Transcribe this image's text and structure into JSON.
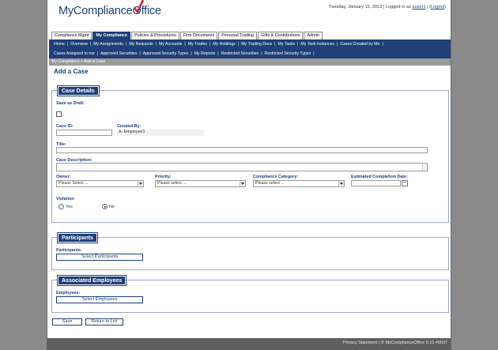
{
  "header": {
    "logo_main": "MyCompliance",
    "logo_check_letter": "O",
    "logo_end": "ffice",
    "date": "Tuesday, January 15, 2013",
    "logged_in_as_label": "| Logged in as",
    "user": "auser1",
    "logout": "Logout"
  },
  "tabs": [
    {
      "label": "Compliance Mgmt"
    },
    {
      "label": "My Compliance"
    },
    {
      "label": "Policies & Procedures"
    },
    {
      "label": "Firm Documents"
    },
    {
      "label": "Personal Trading"
    },
    {
      "label": "Gifts & Contributions"
    },
    {
      "label": "Admin"
    }
  ],
  "nav_row1": [
    {
      "label": "Home"
    },
    {
      "label": "Overview"
    },
    {
      "label": "My Assignments"
    },
    {
      "label": "My Requests"
    },
    {
      "label": "My Accounts"
    },
    {
      "label": "My Trades"
    },
    {
      "label": "My Holdings"
    },
    {
      "label": "My Trading Docs"
    },
    {
      "label": "My Tasks"
    },
    {
      "label": "My Task Instances"
    },
    {
      "label": "Cases Created by Me"
    }
  ],
  "nav_row2": [
    {
      "label": "Cases Assigned to me"
    },
    {
      "label": "Approved Securities"
    },
    {
      "label": "Approved Security Types"
    },
    {
      "label": "My Reports"
    },
    {
      "label": "Restricted Securities"
    },
    {
      "label": "Restricted Security Types"
    }
  ],
  "breadcrumb": "My Compliance »  Add a Case",
  "page_title": "Add a Case",
  "case_details": {
    "legend": "Case Details",
    "save_as_draft_label": "Save as Draft:",
    "case_id_label": "Case ID:",
    "case_id_value": "",
    "created_by_label": "Created By:",
    "created_by_value": "A. Employee1",
    "title_label": "Title:",
    "title_value": "",
    "description_label": "Case Description:",
    "owner_label": "Owner:",
    "owner_value": "Please Select ...",
    "priority_label": "Priority:",
    "priority_value": "Please select ...",
    "category_label": "Compliance Category:",
    "category_value": "Please select ...",
    "est_date_label": "Estimated Completion Date:",
    "est_date_value": "",
    "violation_label": "Violation",
    "yes_label": "Yes",
    "no_label": "No"
  },
  "participants": {
    "legend": "Participants",
    "label": "Participants:",
    "button": "Select Participants"
  },
  "employees": {
    "legend": "Associated Employees",
    "label": "Employees:",
    "button": "Select Employees"
  },
  "actions": {
    "save": "Save",
    "return": "Return to List"
  },
  "footer": {
    "privacy": "Privacy Statement",
    "copyright": "| © MyComplianceOffice 6.10-#9037"
  },
  "colors": {
    "brand": "#1e3f78",
    "background": "#8a8a8a"
  }
}
